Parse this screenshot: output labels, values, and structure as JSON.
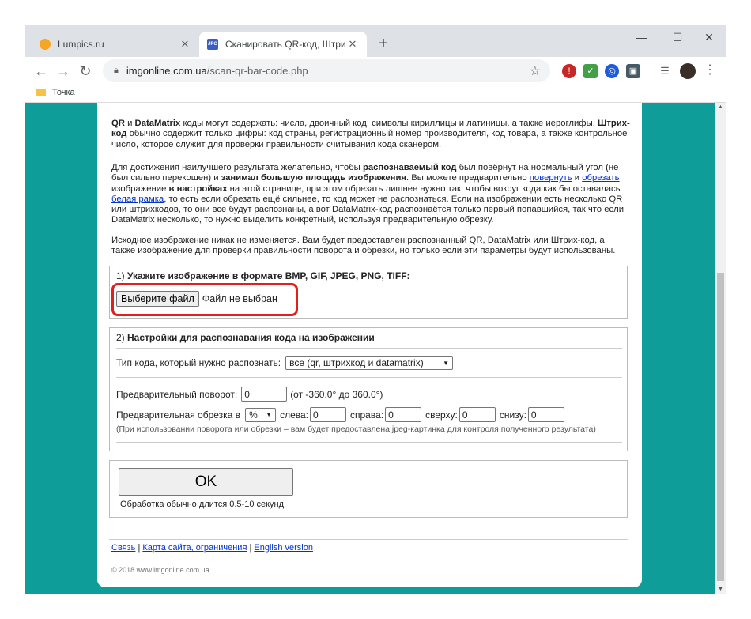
{
  "browser": {
    "tabs": [
      {
        "title": "Lumpics.ru",
        "close": "✕"
      },
      {
        "title": "Сканировать QR-код, Штрих-ко",
        "close": "✕",
        "favicon_text": "JPG"
      }
    ],
    "new_tab": "+",
    "window_controls": {
      "minimize": "—",
      "maximize": "☐",
      "close": "✕"
    },
    "nav": {
      "back": "←",
      "forward": "→",
      "reload": "↻"
    },
    "url_host": "imgonline.com.ua",
    "url_path": "/scan-qr-bar-code.php",
    "bookmarks": [
      {
        "label": "Точка"
      }
    ],
    "menu": "⋮",
    "star": "☆"
  },
  "page": {
    "intro1": {
      "qr": "QR",
      "and": " и ",
      "dm": "DataMatrix",
      "rest1": " коды могут содержать: числа, двоичный код, символы кириллицы и латиницы, а также иероглифы.",
      "barcode": "Штрих-код",
      "rest2": " обычно содержит только цифры: код страны, регистрационный номер производителя, код товара, а также контрольное число, которое служит для проверки правильности считывания кода сканером."
    },
    "intro2": {
      "t1": "Для достижения наилучшего результата желательно, чтобы ",
      "b1": "распознаваемый код",
      "t2": " был повёрнут на нормальный угол (не был сильно перекошен) и ",
      "b2": "занимал большую площадь изображения",
      "t3": ". Вы можете предварительно ",
      "link1": "повернуть",
      "t4": " и ",
      "link2": "обрезать",
      "t5": " изображение ",
      "b3": "в настройках",
      "t6": " на этой странице, при этом обрезать лишнее нужно так, чтобы вокруг кода как бы оставалась ",
      "link3": "белая рамка",
      "t7": ", то есть если обрезать ещё сильнее, то код может не распознаться. Если на изображении есть несколько QR или штрихкодов, то они все будут распознаны, а вот DataMatrix-код распознаётся только первый попавшийся, так что если DataMatrix несколько, то нужно выделить конкретный, используя предварительную обрезку."
    },
    "intro3": "Исходное изображение никак не изменяется. Вам будет предоставлен распознанный QR, DataMatrix или Штрих-код, а также изображение для проверки правильности поворота и обрезки, но только если эти параметры будут использованы.",
    "step1": {
      "num": "1) ",
      "title": "Укажите изображение в формате BMP, GIF, JPEG, PNG, TIFF:",
      "choose_button": "Выберите файл",
      "no_file": "Файл не выбран"
    },
    "step2": {
      "num": "2) ",
      "title": "Настройки для распознавания кода на изображении",
      "code_type_label": "Тип кода, который нужно распознать:",
      "code_type_value": "все (qr, штрихкод и datamatrix)",
      "rotate_label": "Предварительный поворот:",
      "rotate_value": "0",
      "rotate_range": "(от -360.0° до 360.0°)",
      "crop_label": "Предварительная обрезка в",
      "crop_unit": "%",
      "left_label": "слева:",
      "left_value": "0",
      "right_label": "справа:",
      "right_value": "0",
      "top_label": "сверху:",
      "top_value": "0",
      "bottom_label": "снизу:",
      "bottom_value": "0",
      "note": "(При использовании поворота или обрезки – вам будет предоставлена jpeg-картинка для контроля полученного результата)"
    },
    "submit": {
      "ok": "OK",
      "note": "Обработка обычно длится 0.5-10 секунд."
    },
    "footer": {
      "links": [
        "Связь",
        "Карта сайта, ограничения",
        "English version"
      ],
      "sep": " | ",
      "copyright": "© 2018 www.imgonline.com.ua"
    }
  },
  "colors": {
    "page_bg": "#0f9d9a",
    "highlight": "#e0201c",
    "link": "#0033cc"
  }
}
